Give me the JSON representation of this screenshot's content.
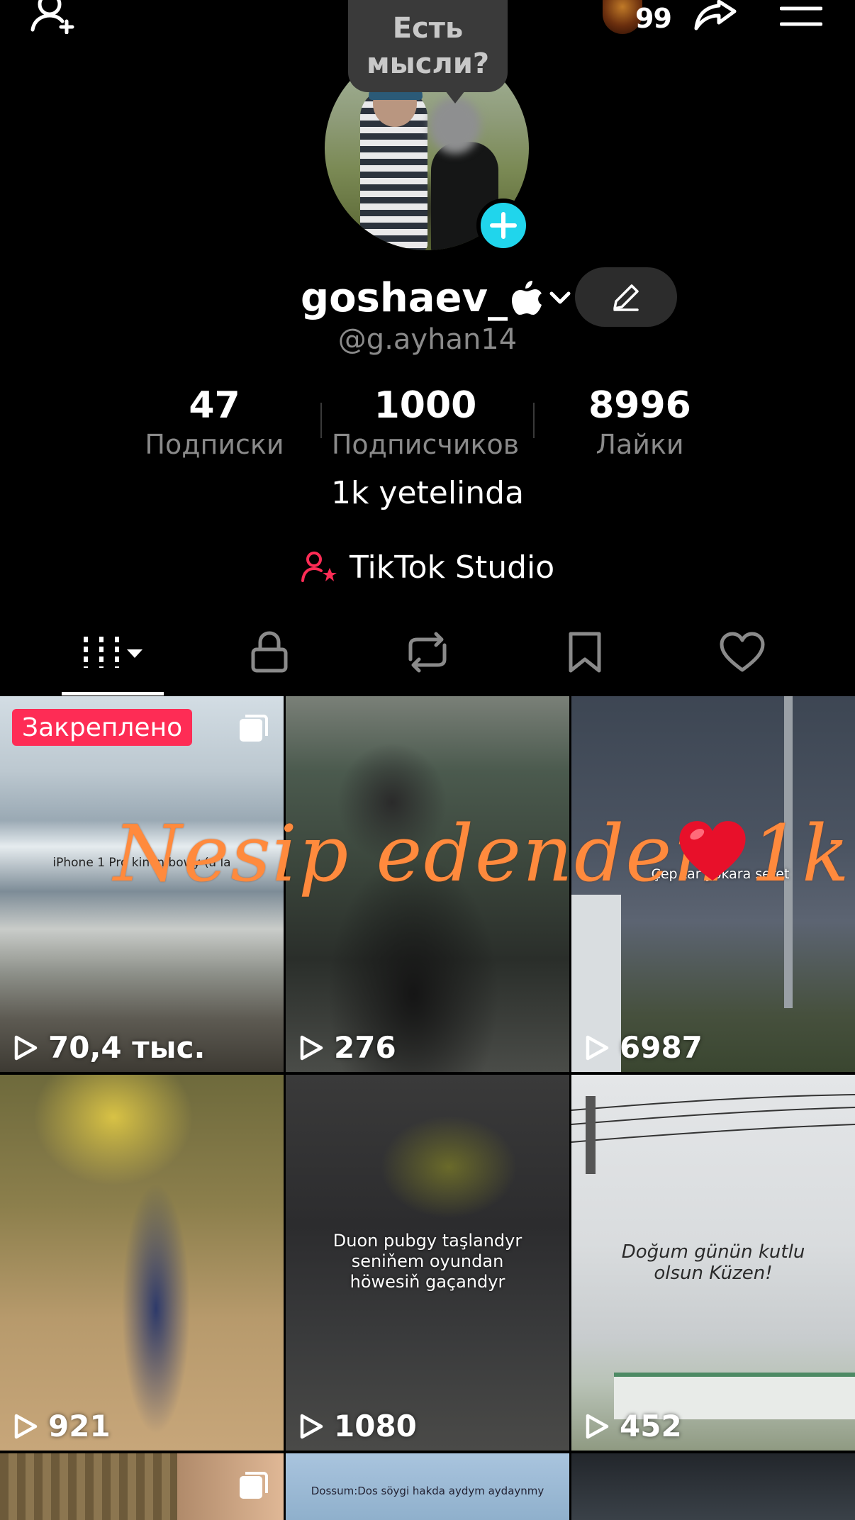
{
  "top_bar": {
    "story_count": "99",
    "thought_bubble": [
      "Есть",
      "мысли?"
    ]
  },
  "profile": {
    "name": "goshaev_",
    "handle": "@g.ayhan14",
    "bio": "1k yetelinda",
    "studio_label": "TikTok Studio"
  },
  "stats": {
    "following": {
      "value": "47",
      "label": "Подписки"
    },
    "followers": {
      "value": "1000",
      "label": "Подписчиков"
    },
    "likes": {
      "value": "8996",
      "label": "Лайки"
    }
  },
  "tabs": [
    {
      "icon": "videos-grid-icon",
      "selected": true
    },
    {
      "icon": "lock-icon",
      "selected": false
    },
    {
      "icon": "repost-icon",
      "selected": false
    },
    {
      "icon": "bookmark-icon",
      "selected": false
    },
    {
      "icon": "heart-icon",
      "selected": false
    }
  ],
  "videos": [
    {
      "views": "70,4 тыс.",
      "pinned_label": "Закреплено",
      "caption": "iPhone 1 Pro kin in bowy (a la"
    },
    {
      "views": "276"
    },
    {
      "views": "6987",
      "caption": "Çep tar yokara seret"
    },
    {
      "views": "921"
    },
    {
      "views": "1080",
      "caption": "Duon pubgy taşlandyr seniňem oyundan höwesiň gaçandyr"
    },
    {
      "views": "452",
      "caption": "Doğum günün kutlu olsun Küzen!"
    },
    {},
    {
      "caption": "Dossum:Dos söygi hakda aydym aydaynmy"
    },
    {}
  ],
  "overlay_caption": "Nesip edenden 1k",
  "colors": {
    "accent_cyan": "#20d5ec",
    "pinned_red": "#fe2c55",
    "overlay_orange": "#ff8a3d",
    "studio_icon": "#fe2c55"
  }
}
